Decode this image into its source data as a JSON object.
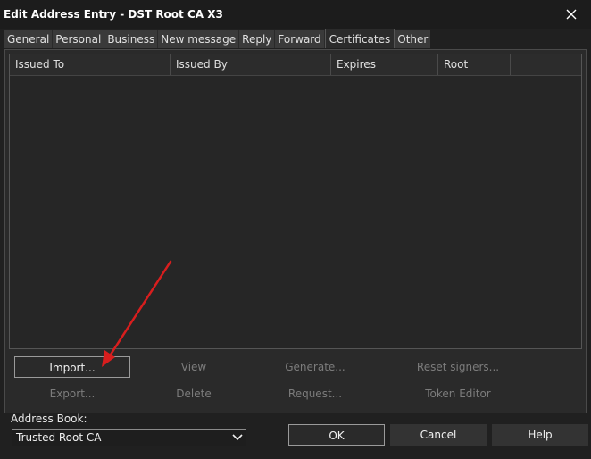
{
  "window": {
    "title": "Edit Address Entry - DST Root CA X3"
  },
  "tabs": [
    {
      "label": "General"
    },
    {
      "label": "Personal"
    },
    {
      "label": "Business"
    },
    {
      "label": "New message"
    },
    {
      "label": "Reply"
    },
    {
      "label": "Forward"
    },
    {
      "label": "Certificates"
    },
    {
      "label": "Other"
    }
  ],
  "certificates": {
    "columns": [
      "Issued To",
      "Issued By",
      "Expires",
      "Root"
    ],
    "rows": [],
    "buttons": {
      "import": "Import...",
      "view": "View",
      "generate": "Generate...",
      "reset_signers": "Reset signers...",
      "export": "Export...",
      "delete": "Delete",
      "request": "Request...",
      "token_editor": "Token Editor"
    }
  },
  "address_book": {
    "label": "Address Book:",
    "value": "Trusted Root CA"
  },
  "dialog_buttons": {
    "ok": "OK",
    "cancel": "Cancel",
    "help": "Help"
  },
  "colors": {
    "annotation_arrow": "#d81e1e",
    "background": "#202020"
  }
}
